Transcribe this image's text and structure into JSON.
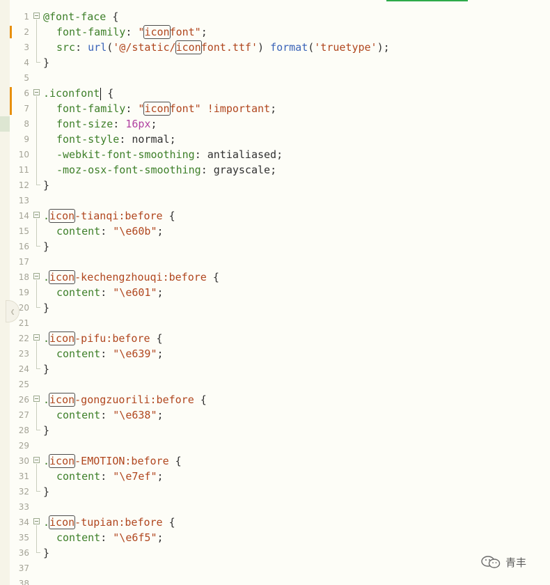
{
  "editor": {
    "lines": [
      {
        "n": "1",
        "tokens": [
          {
            "t": "@font-face",
            "c": "t-at"
          },
          {
            "t": " {",
            "c": "t-punct"
          }
        ]
      },
      {
        "n": "2",
        "tokens": [
          {
            "t": "font-family",
            "c": "t-prop"
          },
          {
            "t": ": ",
            "c": "t-punct"
          },
          {
            "t": "\"",
            "c": "t-str"
          },
          {
            "t": "icon",
            "c": "t-str",
            "box": true
          },
          {
            "t": "font\"",
            "c": "t-str"
          },
          {
            "t": ";",
            "c": "t-punct"
          }
        ],
        "indent": 1
      },
      {
        "n": "3",
        "tokens": [
          {
            "t": "src",
            "c": "t-prop"
          },
          {
            "t": ": ",
            "c": "t-punct"
          },
          {
            "t": "url",
            "c": "t-fn"
          },
          {
            "t": "(",
            "c": "t-punct"
          },
          {
            "t": "'@/static/",
            "c": "t-str"
          },
          {
            "t": "icon",
            "c": "t-str",
            "box": true
          },
          {
            "t": "font.ttf'",
            "c": "t-str"
          },
          {
            "t": ") ",
            "c": "t-punct"
          },
          {
            "t": "format",
            "c": "t-fn"
          },
          {
            "t": "(",
            "c": "t-punct"
          },
          {
            "t": "'truetype'",
            "c": "t-str"
          },
          {
            "t": ");",
            "c": "t-punct"
          }
        ],
        "indent": 1
      },
      {
        "n": "4",
        "tokens": [
          {
            "t": "}",
            "c": "t-punct"
          }
        ]
      },
      {
        "n": "5",
        "tokens": []
      },
      {
        "n": "6",
        "tokens": [
          {
            "t": ".iconfont",
            "c": "t-sel"
          },
          {
            "t": "",
            "c": "t-punct",
            "cursor": true
          },
          {
            "t": " {",
            "c": "t-punct"
          }
        ]
      },
      {
        "n": "7",
        "tokens": [
          {
            "t": "font-family",
            "c": "t-prop"
          },
          {
            "t": ": ",
            "c": "t-punct"
          },
          {
            "t": "\"",
            "c": "t-str"
          },
          {
            "t": "icon",
            "c": "t-str",
            "box": true
          },
          {
            "t": "font\"",
            "c": "t-str"
          },
          {
            "t": " ",
            "c": "t-punct"
          },
          {
            "t": "!important",
            "c": "t-imp"
          },
          {
            "t": ";",
            "c": "t-punct"
          }
        ],
        "indent": 1
      },
      {
        "n": "8",
        "tokens": [
          {
            "t": "font-size",
            "c": "t-prop"
          },
          {
            "t": ": ",
            "c": "t-punct"
          },
          {
            "t": "16px",
            "c": "t-num"
          },
          {
            "t": ";",
            "c": "t-punct"
          }
        ],
        "indent": 1
      },
      {
        "n": "9",
        "tokens": [
          {
            "t": "font-style",
            "c": "t-prop"
          },
          {
            "t": ": ",
            "c": "t-punct"
          },
          {
            "t": "normal",
            "c": "t-plain"
          },
          {
            "t": ";",
            "c": "t-punct"
          }
        ],
        "indent": 1
      },
      {
        "n": "10",
        "tokens": [
          {
            "t": "-webkit-font-smoothing",
            "c": "t-prop"
          },
          {
            "t": ": ",
            "c": "t-punct"
          },
          {
            "t": "antialiased",
            "c": "t-plain"
          },
          {
            "t": ";",
            "c": "t-punct"
          }
        ],
        "indent": 1
      },
      {
        "n": "11",
        "tokens": [
          {
            "t": "-moz-osx-font-smoothing",
            "c": "t-prop"
          },
          {
            "t": ": ",
            "c": "t-punct"
          },
          {
            "t": "grayscale",
            "c": "t-plain"
          },
          {
            "t": ";",
            "c": "t-punct"
          }
        ],
        "indent": 1
      },
      {
        "n": "12",
        "tokens": [
          {
            "t": "}",
            "c": "t-punct"
          }
        ]
      },
      {
        "n": "13",
        "tokens": []
      },
      {
        "n": "14",
        "tokens": [
          {
            "t": ".",
            "c": "t-sel"
          },
          {
            "t": "icon",
            "c": "t-str",
            "box": true
          },
          {
            "t": "-tianqi:before",
            "c": "t-str"
          },
          {
            "t": " {",
            "c": "t-punct"
          }
        ]
      },
      {
        "n": "15",
        "tokens": [
          {
            "t": "content",
            "c": "t-prop"
          },
          {
            "t": ": ",
            "c": "t-punct"
          },
          {
            "t": "\"\\e60b\"",
            "c": "t-str"
          },
          {
            "t": ";",
            "c": "t-punct"
          }
        ],
        "indent": 1
      },
      {
        "n": "16",
        "tokens": [
          {
            "t": "}",
            "c": "t-punct"
          }
        ]
      },
      {
        "n": "17",
        "tokens": []
      },
      {
        "n": "18",
        "tokens": [
          {
            "t": ".",
            "c": "t-sel"
          },
          {
            "t": "icon",
            "c": "t-str",
            "box": true
          },
          {
            "t": "-kechengzhouqi:before",
            "c": "t-str"
          },
          {
            "t": " {",
            "c": "t-punct"
          }
        ]
      },
      {
        "n": "19",
        "tokens": [
          {
            "t": "content",
            "c": "t-prop"
          },
          {
            "t": ": ",
            "c": "t-punct"
          },
          {
            "t": "\"\\e601\"",
            "c": "t-str"
          },
          {
            "t": ";",
            "c": "t-punct"
          }
        ],
        "indent": 1
      },
      {
        "n": "20",
        "tokens": [
          {
            "t": "}",
            "c": "t-punct"
          }
        ]
      },
      {
        "n": "21",
        "tokens": []
      },
      {
        "n": "22",
        "tokens": [
          {
            "t": ".",
            "c": "t-sel"
          },
          {
            "t": "icon",
            "c": "t-str",
            "box": true
          },
          {
            "t": "-pifu:before",
            "c": "t-str"
          },
          {
            "t": " {",
            "c": "t-punct"
          }
        ]
      },
      {
        "n": "23",
        "tokens": [
          {
            "t": "content",
            "c": "t-prop"
          },
          {
            "t": ": ",
            "c": "t-punct"
          },
          {
            "t": "\"\\e639\"",
            "c": "t-str"
          },
          {
            "t": ";",
            "c": "t-punct"
          }
        ],
        "indent": 1
      },
      {
        "n": "24",
        "tokens": [
          {
            "t": "}",
            "c": "t-punct"
          }
        ]
      },
      {
        "n": "25",
        "tokens": []
      },
      {
        "n": "26",
        "tokens": [
          {
            "t": ".",
            "c": "t-sel"
          },
          {
            "t": "icon",
            "c": "t-str",
            "box": true
          },
          {
            "t": "-gongzuorili:before",
            "c": "t-str"
          },
          {
            "t": " {",
            "c": "t-punct"
          }
        ]
      },
      {
        "n": "27",
        "tokens": [
          {
            "t": "content",
            "c": "t-prop"
          },
          {
            "t": ": ",
            "c": "t-punct"
          },
          {
            "t": "\"\\e638\"",
            "c": "t-str"
          },
          {
            "t": ";",
            "c": "t-punct"
          }
        ],
        "indent": 1
      },
      {
        "n": "28",
        "tokens": [
          {
            "t": "}",
            "c": "t-punct"
          }
        ]
      },
      {
        "n": "29",
        "tokens": []
      },
      {
        "n": "30",
        "tokens": [
          {
            "t": ".",
            "c": "t-sel"
          },
          {
            "t": "icon",
            "c": "t-str",
            "box": true
          },
          {
            "t": "-EMOTION:before",
            "c": "t-str"
          },
          {
            "t": " {",
            "c": "t-punct"
          }
        ]
      },
      {
        "n": "31",
        "tokens": [
          {
            "t": "content",
            "c": "t-prop"
          },
          {
            "t": ": ",
            "c": "t-punct"
          },
          {
            "t": "\"\\e7ef\"",
            "c": "t-str"
          },
          {
            "t": ";",
            "c": "t-punct"
          }
        ],
        "indent": 1
      },
      {
        "n": "32",
        "tokens": [
          {
            "t": "}",
            "c": "t-punct"
          }
        ]
      },
      {
        "n": "33",
        "tokens": []
      },
      {
        "n": "34",
        "tokens": [
          {
            "t": ".",
            "c": "t-sel"
          },
          {
            "t": "icon",
            "c": "t-str",
            "box": true
          },
          {
            "t": "-tupian:before",
            "c": "t-str"
          },
          {
            "t": " {",
            "c": "t-punct"
          }
        ]
      },
      {
        "n": "35",
        "tokens": [
          {
            "t": "content",
            "c": "t-prop"
          },
          {
            "t": ": ",
            "c": "t-punct"
          },
          {
            "t": "\"\\e6f5\"",
            "c": "t-str"
          },
          {
            "t": ";",
            "c": "t-punct"
          }
        ],
        "indent": 1
      },
      {
        "n": "36",
        "tokens": [
          {
            "t": "}",
            "c": "t-punct"
          }
        ]
      },
      {
        "n": "37",
        "tokens": []
      },
      {
        "n": "38",
        "tokens": []
      }
    ],
    "fold_starts": [
      "1",
      "6",
      "14",
      "18",
      "22",
      "26",
      "30",
      "34"
    ],
    "fold_ends": [
      "4",
      "12",
      "16",
      "20",
      "24",
      "28",
      "32",
      "36"
    ],
    "colors": {
      "background": "#fdfdf7",
      "change_marker": "#e8900e",
      "top_marker": "#2eaa4a"
    }
  },
  "watermark": {
    "icon": "wechat-icon",
    "text": "青丰"
  }
}
